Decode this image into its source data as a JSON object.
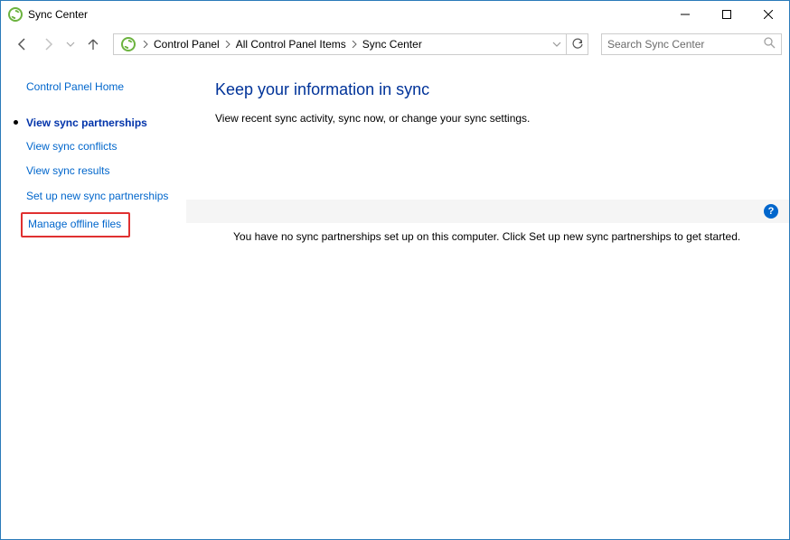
{
  "window": {
    "title": "Sync Center"
  },
  "breadcrumb": {
    "items": [
      "Control Panel",
      "All Control Panel Items",
      "Sync Center"
    ]
  },
  "search": {
    "placeholder": "Search Sync Center"
  },
  "sidebar": {
    "home": "Control Panel Home",
    "active": "View sync partnerships",
    "links": {
      "conflicts": "View sync conflicts",
      "results": "View sync results",
      "setup": "Set up new sync partnerships",
      "offline": "Manage offline files"
    }
  },
  "main": {
    "heading": "Keep your information in sync",
    "description": "View recent sync activity, sync now, or change your sync settings.",
    "empty": "You have no sync partnerships set up on this computer. Click Set up new sync partnerships to get started."
  },
  "help": {
    "glyph": "?"
  }
}
